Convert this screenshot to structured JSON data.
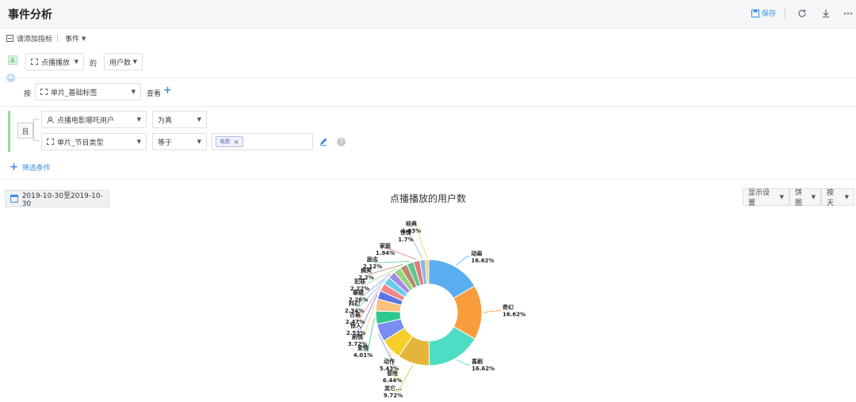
{
  "header": {
    "title": "事件分析",
    "save_label": "保存",
    "icons": [
      "save-icon",
      "refresh-icon",
      "download-icon",
      "more-icon"
    ]
  },
  "metrics": {
    "add_metric_label": "请添加指标",
    "event_label": "事件",
    "badge": "A",
    "event_select": "点播播放",
    "of_label": "的",
    "measure_select": "用户数"
  },
  "group_by": {
    "by_label": "按",
    "dimension_select": "单片_基础标签",
    "view_label": "查看"
  },
  "filters": {
    "logic_label": "且",
    "rows": [
      {
        "field": "点播电影哪吒用户",
        "operator": "为真"
      },
      {
        "field": "单片_节目类型",
        "operator": "等于",
        "tag": "电影",
        "tag_remove": "×"
      }
    ],
    "help": "?",
    "add_filter_label": "筛选条件"
  },
  "toolbar": {
    "date_range": "2019-10-30至2019-10-30",
    "display_settings": "显示设置",
    "chart_type": "饼图",
    "granularity": "按天"
  },
  "chart_data": {
    "type": "pie",
    "style": "donut",
    "title": "点播播放的用户数",
    "slices": [
      {
        "label": "动画",
        "value": 16.62,
        "display": "16.62%",
        "color": "#5aaef0"
      },
      {
        "label": "奇幻",
        "value": 16.62,
        "display": "16.62%",
        "color": "#f99d3c"
      },
      {
        "label": "喜剧",
        "value": 16.62,
        "display": "16.62%",
        "color": "#4fdcc4"
      },
      {
        "label": "其它...",
        "value": 9.72,
        "display": "9.72%",
        "color": "#e3b53a"
      },
      {
        "label": "冒险",
        "value": 6.44,
        "display": "6.44%",
        "color": "#f8cf2a"
      },
      {
        "label": "动作",
        "value": 5.43,
        "display": "5.43%",
        "color": "#7a8df0"
      },
      {
        "label": "爱情",
        "value": 4.01,
        "display": "4.01%",
        "color": "#2fc98e"
      },
      {
        "label": "剧情",
        "value": 3.72,
        "display": "3.72%",
        "color": "#fcc07e"
      },
      {
        "label": "惊人",
        "value": 2.53,
        "display": "2.53%",
        "color": "#5a73e6"
      },
      {
        "label": "古装",
        "value": 2.47,
        "display": "2.47%",
        "color": "#f08a8a"
      },
      {
        "label": "科幻",
        "value": 2.34,
        "display": "2.34%",
        "color": "#66ccee"
      },
      {
        "label": "悬疑",
        "value": 2.26,
        "display": "2.26%",
        "color": "#a48ae8"
      },
      {
        "label": "犯罪",
        "value": 2.22,
        "display": "2.22%",
        "color": "#9ad27a"
      },
      {
        "label": "搞笑",
        "value": 2.2,
        "display": "2.2%",
        "color": "#b48b6a"
      },
      {
        "label": "励志",
        "value": 2.12,
        "display": "2.12%",
        "color": "#5ec690"
      },
      {
        "label": "家庭",
        "value": 1.94,
        "display": "1.94%",
        "color": "#e07a7a"
      },
      {
        "label": "惊悚",
        "value": 1.7,
        "display": "1.7%",
        "color": "#8ab8e8"
      },
      {
        "label": "经典",
        "value": 1.03,
        "display": "1.03%",
        "color": "#f4d06a"
      }
    ]
  }
}
